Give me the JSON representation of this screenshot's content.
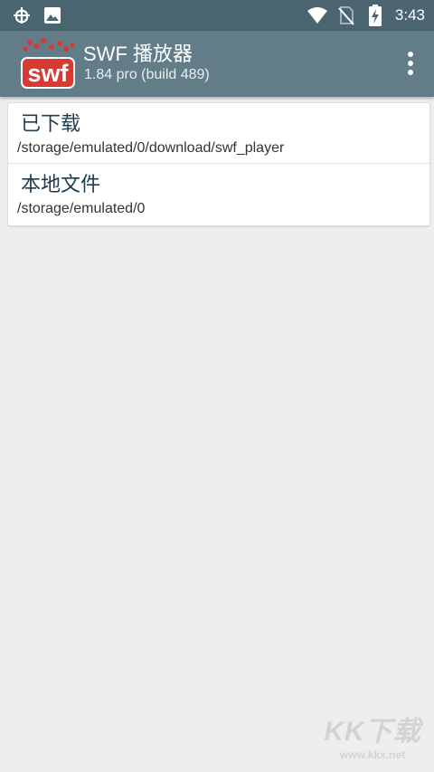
{
  "status_bar": {
    "time": "3:43",
    "left_icons": [
      "bug-icon",
      "image-icon"
    ],
    "right_icons": [
      "wifi-icon",
      "no-sim-icon",
      "battery-charging-icon"
    ]
  },
  "app_bar": {
    "logo_text": "swf",
    "title": "SWF 播放器",
    "subtitle": "1.84 pro (build 489)",
    "menu_icon": "overflow-menu-icon"
  },
  "list": {
    "items": [
      {
        "title": "已下载",
        "path": "/storage/emulated/0/download/swf_player"
      },
      {
        "title": "本地文件",
        "path": "/storage/emulated/0"
      }
    ]
  },
  "watermark": {
    "brand": "KK下载",
    "domain": "www.kkx.net"
  },
  "colors": {
    "status_bar": "#4a6470",
    "app_bar": "#627d88",
    "background": "#eeeeee",
    "logo_red": "#d63a33",
    "item_title": "#1e3c4e"
  }
}
